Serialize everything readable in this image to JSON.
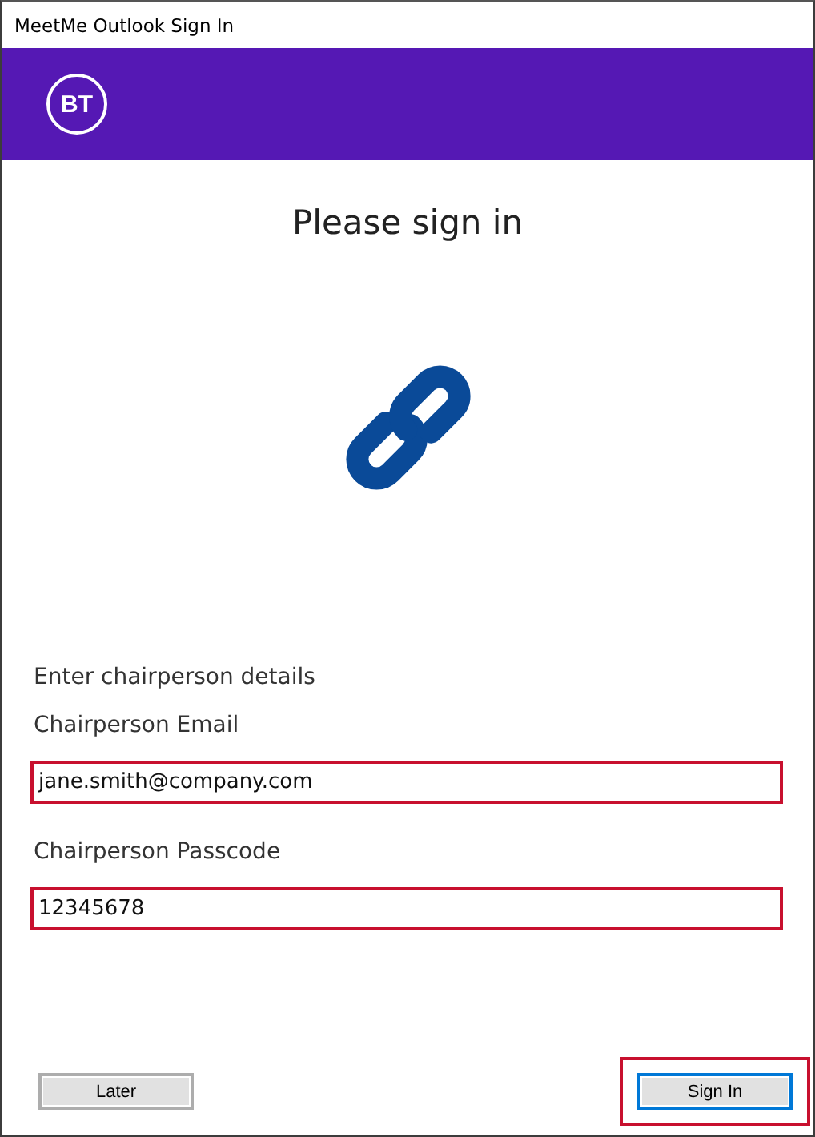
{
  "window": {
    "title": "MeetMe Outlook Sign In"
  },
  "brand": {
    "logo_text": "BT"
  },
  "heading": "Please sign in",
  "section_label": "Enter chairperson details",
  "fields": [
    {
      "label": "Chairperson Email",
      "value": "jane.smith@company.com",
      "highlighted": true
    },
    {
      "label": "Chairperson Passcode",
      "value": "12345678",
      "highlighted": true
    }
  ],
  "buttons": [
    {
      "label": "Later",
      "kind": "secondary",
      "highlighted": false
    },
    {
      "label": "Sign In",
      "kind": "primary",
      "highlighted": true
    }
  ]
}
